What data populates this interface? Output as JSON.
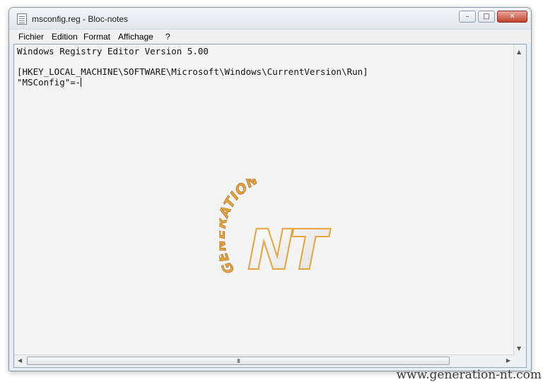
{
  "window": {
    "title": "msconfig.reg - Bloc-notes",
    "buttons": {
      "minimize": "–",
      "maximize": "□",
      "close": "✕"
    }
  },
  "menu": {
    "items": [
      "Fichier",
      "Edition",
      "Format",
      "Affichage",
      "?"
    ]
  },
  "editor": {
    "lines": [
      "Windows Registry Editor Version 5.00",
      "",
      "[HKEY_LOCAL_MACHINE\\SOFTWARE\\Microsoft\\Windows\\CurrentVersion\\Run]",
      "\"MSConfig\"=-"
    ]
  },
  "scrollbars": {
    "up_arrow": "▲",
    "down_arrow": "▼",
    "left_arrow": "◀",
    "right_arrow": "▶",
    "grip": "III"
  },
  "logo": {
    "arc_text": "GENERATION",
    "letters": "NT"
  },
  "watermark": "www.generation-nt.com",
  "colors": {
    "close_button": "#c2422c",
    "logo_orange": "#e8a33a",
    "editor_bg": "#f4f4f4"
  },
  "icons": {
    "app": "notepad-icon"
  }
}
